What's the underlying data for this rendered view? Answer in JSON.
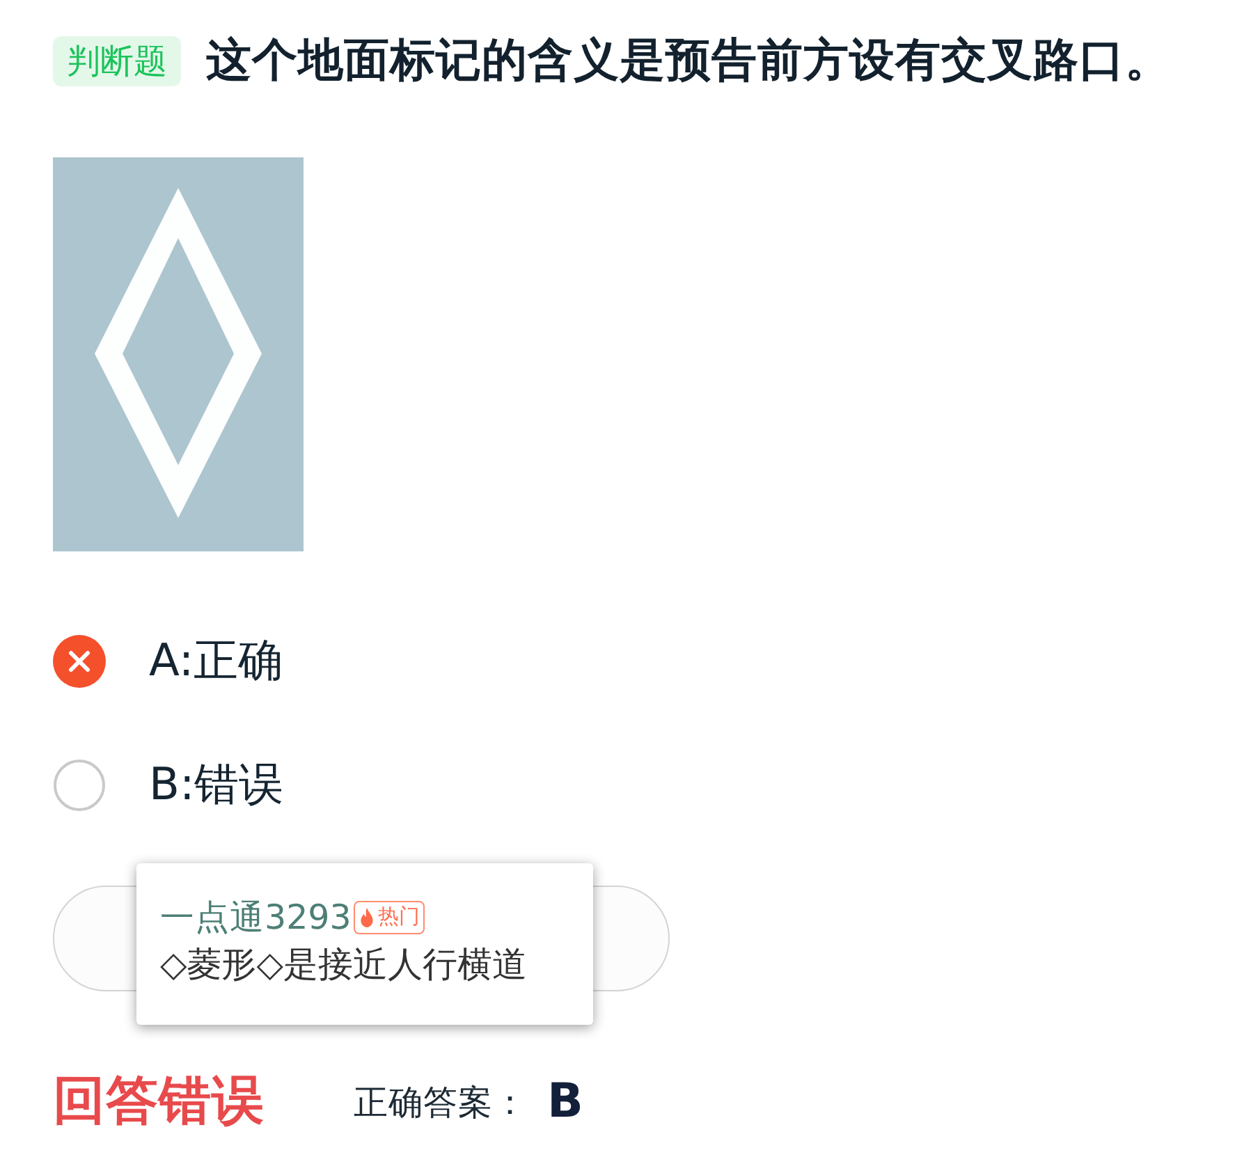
{
  "question": {
    "type_tag": "判断题",
    "text": "这个地面标记的含义是预告前方设有交叉路口。"
  },
  "options": [
    {
      "label": "A:正确",
      "selected": true
    },
    {
      "label": "B:错误",
      "selected": false
    }
  ],
  "popup": {
    "user": "一点通3293",
    "badge": "热门",
    "comment": "◇菱形◇是接近人行横道"
  },
  "result": {
    "correct": false,
    "verdict": "回答错误",
    "correct_label": "正确答案：",
    "correct_answer": "B"
  }
}
